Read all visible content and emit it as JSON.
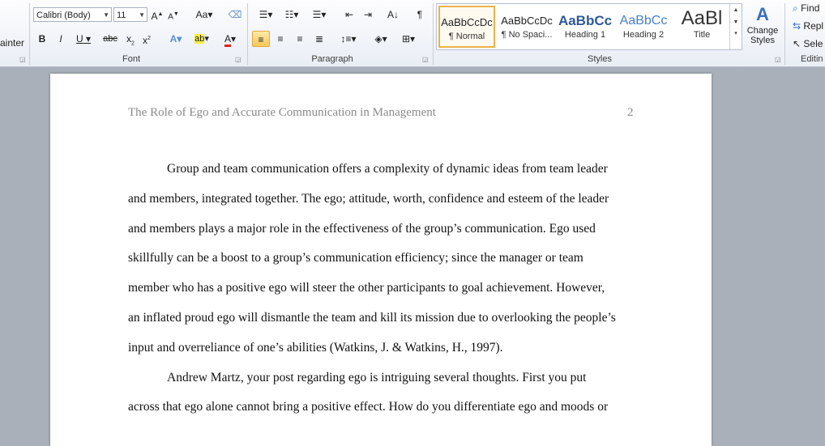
{
  "ribbon": {
    "clipboard_partial": "ainter",
    "font": {
      "name": "Calibri (Body)",
      "size": "11",
      "group_label": "Font"
    },
    "paragraph": {
      "group_label": "Paragraph"
    },
    "styles": {
      "group_label": "Styles",
      "items": [
        {
          "sample": "AaBbCcDc",
          "name": "¶ Normal"
        },
        {
          "sample": "AaBbCcDc",
          "name": "¶ No Spaci..."
        },
        {
          "sample": "AaBbCc",
          "name": "Heading 1"
        },
        {
          "sample": "AaBbCc",
          "name": "Heading 2"
        },
        {
          "sample": "AaBl",
          "name": "Title"
        }
      ],
      "change_styles": "Change Styles"
    },
    "editing": {
      "group_label": "Editin",
      "find": "Find",
      "replace": "Repl",
      "select": "Sele"
    }
  },
  "document": {
    "header_title": "The Role of Ego and Accurate Communication in Management",
    "page_number": "2",
    "lines": [
      "Group and team communication offers a complexity of dynamic ideas from team leader",
      "and members, integrated together. The ego; attitude, worth, confidence and esteem of the leader",
      "and members plays a major role in the effectiveness of the group’s communication.  Ego used",
      "skillfully can be a boost to a group’s communication efficiency; since the manager or team",
      "member who has a positive ego will steer the other participants to goal achievement. However,",
      "an inflated proud ego will dismantle the team and kill its mission due to overlooking the people’s",
      "input and overreliance of one’s abilities (Watkins, J. & Watkins, H., 1997).",
      "Andrew Martz, your post regarding ego is intriguing several thoughts. First you put",
      "across that ego alone cannot bring a positive effect. How do you differentiate ego and moods or"
    ]
  }
}
